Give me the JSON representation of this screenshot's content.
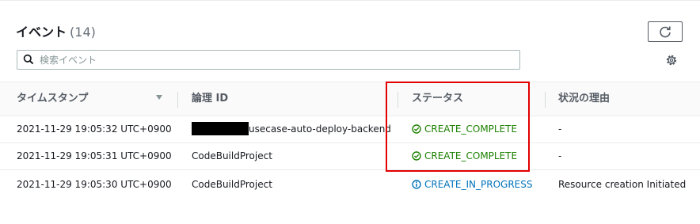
{
  "header": {
    "title": "イベント",
    "count": "(14)"
  },
  "search": {
    "placeholder": "検索イベント",
    "value": ""
  },
  "table": {
    "columns": [
      "タイムスタンプ",
      "論理 ID",
      "ステータス",
      "状況の理由"
    ],
    "rows": [
      {
        "timestamp": "2021-11-29 19:05:32 UTC+0900",
        "logical_id": "usecase-auto-deploy-backend",
        "logical_id_redacted": true,
        "status": "CREATE_COMPLETE",
        "status_kind": "complete",
        "reason": "-"
      },
      {
        "timestamp": "2021-11-29 19:05:31 UTC+0900",
        "logical_id": "CodeBuildProject",
        "logical_id_redacted": false,
        "status": "CREATE_COMPLETE",
        "status_kind": "complete",
        "reason": "-"
      },
      {
        "timestamp": "2021-11-29 19:05:30 UTC+0900",
        "logical_id": "CodeBuildProject",
        "logical_id_redacted": false,
        "status": "CREATE_IN_PROGRESS",
        "status_kind": "in-progress",
        "reason": "Resource creation Initiated"
      }
    ]
  },
  "colors": {
    "complete": "#1d8102",
    "in_progress": "#0073bb",
    "highlight": "#e30000"
  },
  "icons": {
    "refresh": "refresh-icon",
    "search": "search-icon",
    "settings": "gear-icon",
    "complete": "check-circle-icon",
    "in_progress": "info-circle-icon"
  }
}
